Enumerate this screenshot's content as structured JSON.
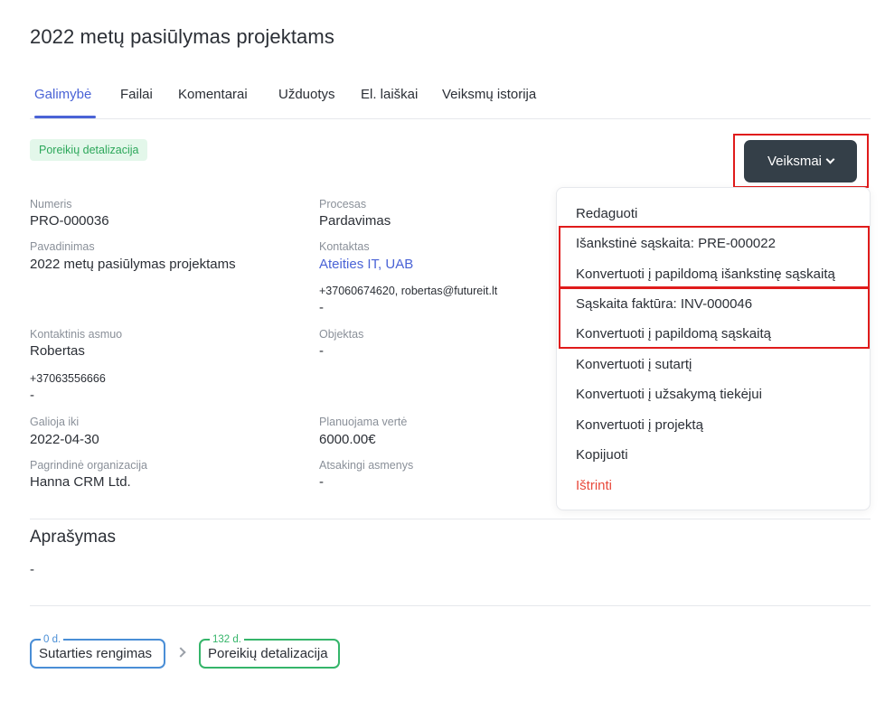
{
  "page": {
    "title": "2022 metų pasiūlymas projektams"
  },
  "tabs": [
    {
      "label": "Galimybė",
      "active": true
    },
    {
      "label": "Failai"
    },
    {
      "label": "Komentarai"
    },
    {
      "label": "Užduotys"
    },
    {
      "label": "El. laiškai"
    },
    {
      "label": "Veiksmų istorija"
    }
  ],
  "status_badge": "Poreikių detalizacija",
  "actions_button": {
    "label": "Veiksmai"
  },
  "details": {
    "numeris": {
      "label": "Numeris",
      "value": "PRO-000036"
    },
    "procesas": {
      "label": "Procesas",
      "value": "Pardavimas"
    },
    "pavadinimas": {
      "label": "Pavadinimas",
      "value": "2022 metų pasiūlymas projektams"
    },
    "kontaktas": {
      "label": "Kontaktas",
      "value": "Ateities IT, UAB",
      "phone_email": "+37060674620, robertas@futureit.lt",
      "extra": "-"
    },
    "kontaktinis_asmuo": {
      "label": "Kontaktinis asmuo",
      "value": "Robertas",
      "phone": "+37063556666",
      "extra": "-"
    },
    "objektas": {
      "label": "Objektas",
      "value": "-"
    },
    "galioja_iki": {
      "label": "Galioja iki",
      "value": "2022-04-30"
    },
    "planuojama_verte": {
      "label": "Planuojama vertė",
      "value": "6000.00€"
    },
    "pagrindine_organizacija": {
      "label": "Pagrindinė organizacija",
      "value": "Hanna CRM Ltd."
    },
    "atsakingi_asmenys": {
      "label": "Atsakingi asmenys",
      "value": "-"
    }
  },
  "menu": {
    "items": [
      {
        "label": "Redaguoti"
      },
      {
        "label": "Išankstinė sąskaita: PRE-000022"
      },
      {
        "label": "Konvertuoti į papildomą išankstinę sąskaitą"
      },
      {
        "label": "Sąskaita faktūra: INV-000046"
      },
      {
        "label": "Konvertuoti į papildomą sąskaitą"
      },
      {
        "label": "Konvertuoti į sutartį"
      },
      {
        "label": "Konvertuoti į užsakymą tiekėjui"
      },
      {
        "label": "Konvertuoti į projektą"
      },
      {
        "label": "Kopijuoti"
      },
      {
        "label": "Ištrinti"
      }
    ]
  },
  "description": {
    "title": "Aprašymas",
    "value": "-"
  },
  "pipeline": [
    {
      "days": "0 d.",
      "label": "Sutarties rengimas",
      "color": "#4a8ed6"
    },
    {
      "days": "132 d.",
      "label": "Poreikių detalizacija",
      "color": "#35b56a"
    }
  ],
  "colors": {
    "accent": "#4a63d6",
    "button_dark": "#343f48",
    "danger": "#e84a3c",
    "highlight": "#e01b1b"
  }
}
